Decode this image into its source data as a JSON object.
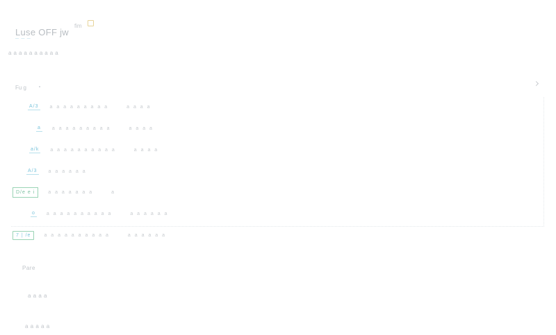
{
  "header": {
    "title": "Luse OFF jw",
    "title_suffix": "fim",
    "title_sub": "— — —",
    "subtitle": "a a a a a a a a a a"
  },
  "dropdown": {
    "label": "Fu g"
  },
  "rows": [
    {
      "tag": "A/3",
      "text": "a a a a a a a a a",
      "extra": "a a a a",
      "style": "plain"
    },
    {
      "tag": "a",
      "text": "a a a a a a a a a",
      "extra": "a a a a",
      "style": "plain"
    },
    {
      "tag": "a/k",
      "text": "a a a a a a a a a a",
      "extra": "a a a a",
      "style": "plain"
    },
    {
      "tag": "A/3",
      "text": "a a a a a a",
      "extra": "",
      "style": "plain"
    },
    {
      "tag": "D/e e i",
      "text": "a a a a a a a",
      "extra": "a",
      "style": "boxed"
    },
    {
      "tag": "o",
      "text": "a a a a a a a a a a",
      "extra": "a a a a a a",
      "style": "plain"
    },
    {
      "tag": "7 | /e",
      "text": "a a a a a a a a a a",
      "extra": "a a a a a a",
      "style": "boxed-alt"
    }
  ],
  "footer": {
    "item1": "Pare",
    "item2": "a a a a",
    "item3": "a a a a a"
  }
}
